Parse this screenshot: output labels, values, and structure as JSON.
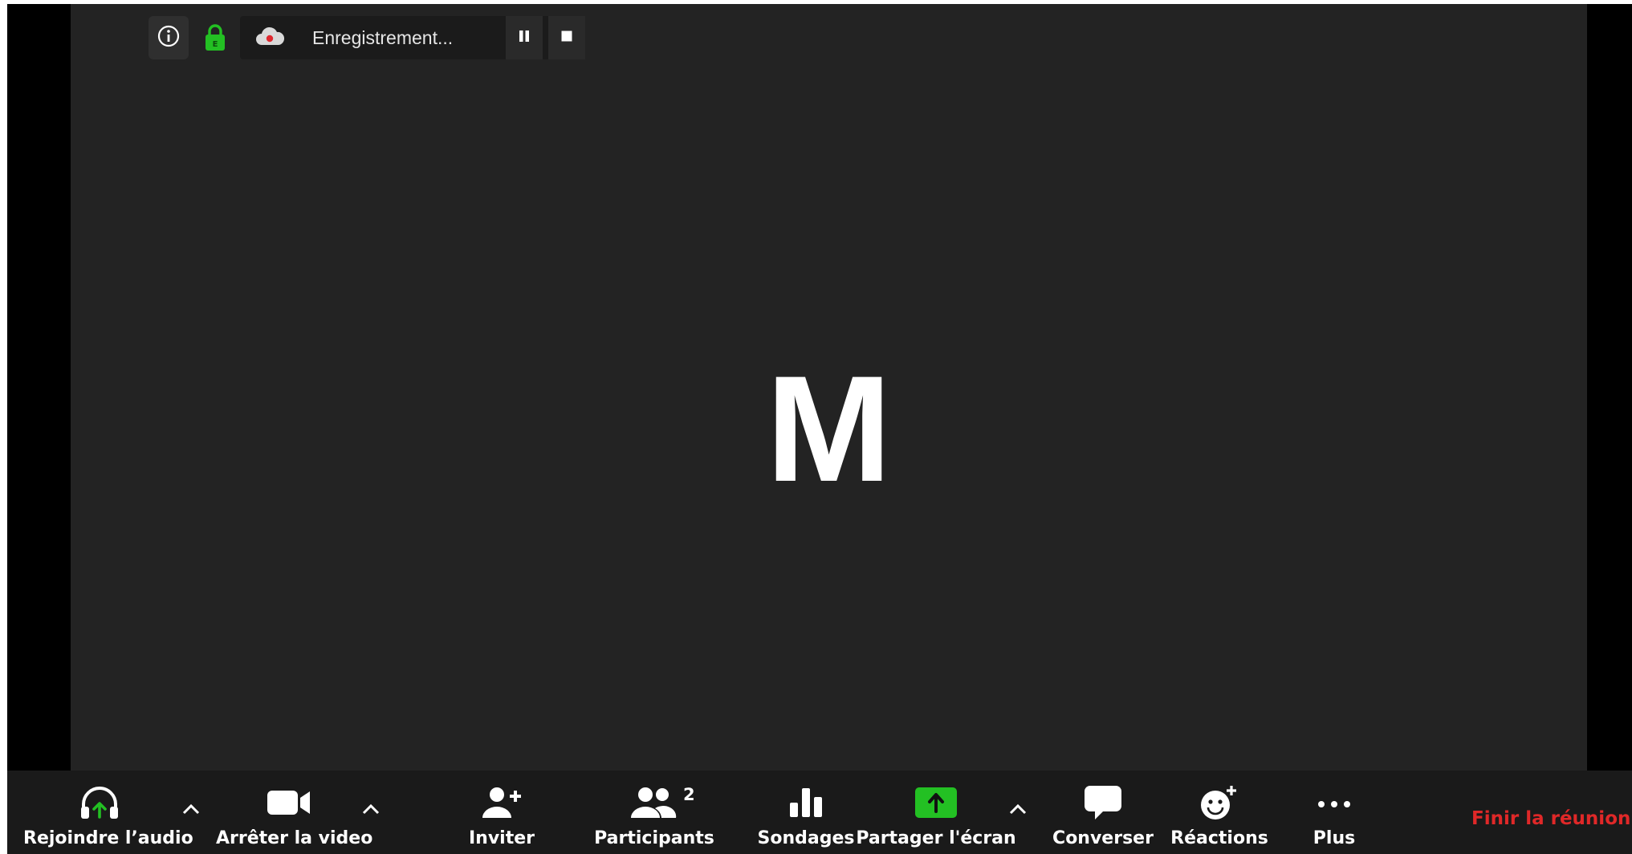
{
  "stage": {
    "avatar_initial": "M"
  },
  "recording": {
    "status_text": "Enregistrement...",
    "pause_icon": "pause-icon",
    "stop_icon": "stop-icon",
    "cloud_icon": "cloud-record-icon"
  },
  "security": {
    "info_icon": "info-icon",
    "lock_icon": "lock-icon",
    "lock_color": "#23c023"
  },
  "toolbar": {
    "join_audio": "Rejoindre l’audio",
    "stop_video": "Arrêter la video",
    "invite": "Inviter",
    "participants": "Participants",
    "participants_count": "2",
    "polls": "Sondages",
    "share_screen": "Partager l'écran",
    "chat": "Converser",
    "reactions": "Réactions",
    "more": "Plus",
    "end_meeting": "Finir la réunion"
  },
  "colors": {
    "stage_bg": "#232323",
    "toolbar_bg": "#1a1a1a",
    "share_green": "#23c023",
    "end_red": "#e02828"
  }
}
